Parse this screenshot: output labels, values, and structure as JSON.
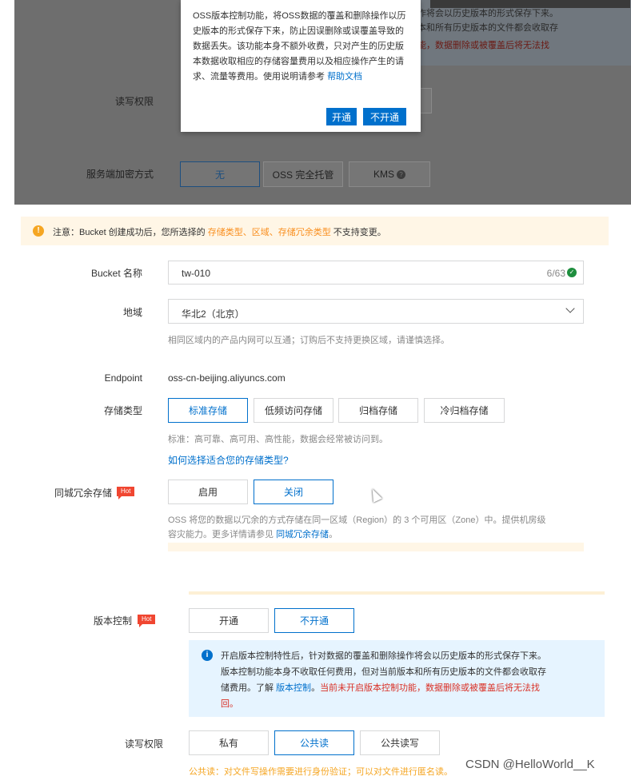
{
  "screenshot_top": {
    "popover": {
      "text": "OSS版本控制功能，将OSS数据的覆盖和删除操作以历史版本的形式保存下来，防止因误删除或误覆盖导致的数据丢失。该功能本身不额外收费，只对产生的历史版本数据收取相应的存储容量费用以及相应操作产生的请求、流量等费用。使用说明请参考",
      "link": "帮助文档",
      "ok": "开通",
      "cancel": "不开通"
    },
    "bg_text_1": "作将会以历史版本的形式保存下来。",
    "bg_text_2": "本和所有历史版本的文件都会收取存",
    "bg_text_3": "能，数据删除或被覆盖后将无法找",
    "rw_label": "读写权限",
    "enc_label": "服务端加密方式",
    "enc_options": [
      "无",
      "OSS 完全托管",
      "KMS"
    ]
  },
  "notice": {
    "prefix": "注意：Bucket 创建成功后，您所选择的 ",
    "hl": "存储类型、区域、存储冗余类型",
    "suffix": " 不支持变更。"
  },
  "form": {
    "bucket_label": "Bucket 名称",
    "bucket_value": "tw-010",
    "bucket_count": "6/63",
    "region_label": "地域",
    "region_value": "华北2（北京）",
    "region_help": "相同区域内的产品内网可以互通；订购后不支持更换区域，请谨慎选择。",
    "endpoint_label": "Endpoint",
    "endpoint_value": "oss-cn-beijing.aliyuncs.com",
    "storage_label": "存储类型",
    "storage_options": [
      "标准存储",
      "低频访问存储",
      "归档存储",
      "冷归档存储"
    ],
    "storage_help": "标准：高可靠、高可用、高性能，数据会经常被访问到。",
    "storage_link": "如何选择适合您的存储类型?",
    "redundancy_label": "同城冗余存储",
    "hot": "Hot",
    "redundancy_options": [
      "启用",
      "关闭"
    ],
    "redundancy_help_1": "OSS 将您的数据以冗余的方式存储在同一区域（Region）的 3 个可用区（Zone）中。提供机房级",
    "redundancy_help_2": "容灾能力。更多详情请参见 ",
    "redundancy_link": "同城冗余存储",
    "redundancy_help_3": "。"
  },
  "bottom": {
    "version_label": "版本控制",
    "hot": "Hot",
    "version_options": [
      "开通",
      "不开通"
    ],
    "info_1": "开启版本控制特性后，针对数据的覆盖和删除操作将会以历史版本的形式保存下来。",
    "info_2": "版本控制功能本身不收取任何费用，但对当前版本和所有历史版本的文件都会收取存",
    "info_3a": "储费用。了解 ",
    "info_link": "版本控制",
    "info_3b": "。",
    "info_red_1": "当前未开启版本控制功能，数据删除或被覆盖后将无法找",
    "info_red_2": "回。",
    "rw_label": "读写权限",
    "rw_options": [
      "私有",
      "公共读",
      "公共读写"
    ],
    "rw_warning": "公共读：对文件写操作需要进行身份验证；可以对文件进行匿名读。"
  },
  "watermark": "CSDN @HelloWorld__K"
}
